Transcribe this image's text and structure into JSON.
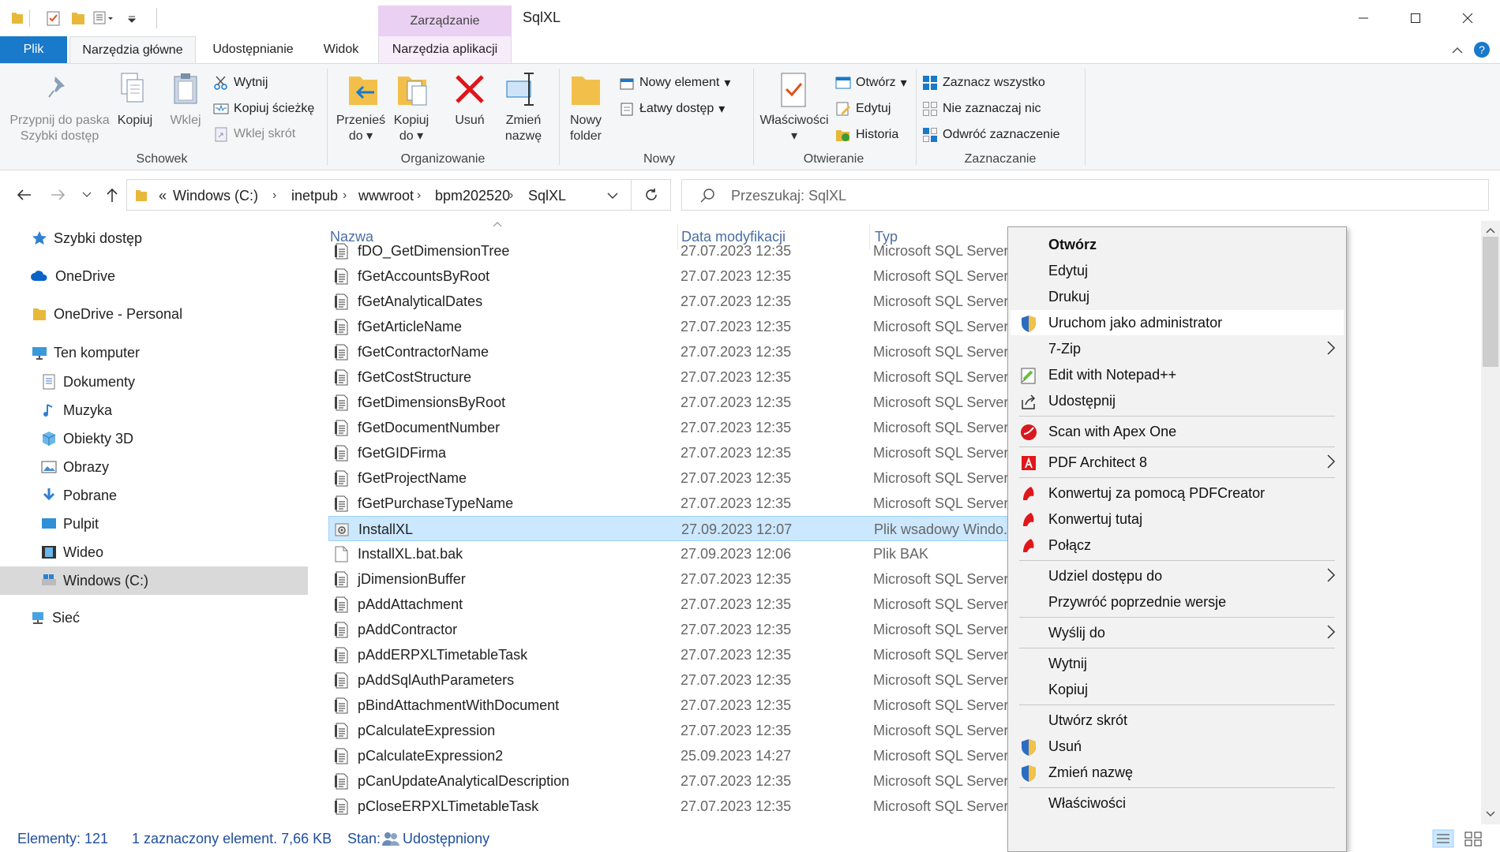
{
  "window": {
    "title": "SqlXL",
    "context_group": "Zarządzanie"
  },
  "ribbon_tabs": [
    {
      "label": "Plik"
    },
    {
      "label": "Narzędzia główne"
    },
    {
      "label": "Udostępnianie"
    },
    {
      "label": "Widok"
    },
    {
      "label": "Narzędzia aplikacji"
    }
  ],
  "ribbon": {
    "schowek": {
      "pin_line1": "Przypnij do paska",
      "pin_line2": "Szybki dostęp",
      "copy": "Kopiuj",
      "paste": "Wklej",
      "cut": "Wytnij",
      "copy_path": "Kopiuj ścieżkę",
      "paste_shortcut": "Wklej skrót",
      "group": "Schowek"
    },
    "organizowanie": {
      "move_line1": "Przenieś",
      "move_line2": "do",
      "copyto_line1": "Kopiuj",
      "copyto_line2": "do",
      "delete": "Usuń",
      "rename_line1": "Zmień",
      "rename_line2": "nazwę",
      "group": "Organizowanie"
    },
    "nowy": {
      "new_folder_line1": "Nowy",
      "new_folder_line2": "folder",
      "new_item": "Nowy element",
      "easy_access": "Łatwy dostęp",
      "group": "Nowy"
    },
    "otwieranie": {
      "properties": "Właściwości",
      "open": "Otwórz",
      "edit": "Edytuj",
      "history": "Historia",
      "group": "Otwieranie"
    },
    "zaznaczanie": {
      "select_all": "Zaznacz wszystko",
      "select_none": "Nie zaznaczaj nic",
      "invert": "Odwróć zaznaczenie",
      "group": "Zaznaczanie"
    }
  },
  "address": {
    "overflow": "«",
    "crumbs": [
      "Windows (C:)",
      "inetpub",
      "wwwroot",
      "bpm202520",
      "SqlXL"
    ],
    "search_placeholder": "Przeszukaj: SqlXL"
  },
  "nav": [
    {
      "label": "Szybki dostęp",
      "icon": "star-icon"
    },
    {
      "label": "OneDrive",
      "icon": "cloud-icon"
    },
    {
      "label": "OneDrive - Personal",
      "icon": "folder-icon"
    },
    {
      "label": "Ten komputer",
      "icon": "computer-icon"
    },
    {
      "label": "Dokumenty",
      "icon": "documents-icon"
    },
    {
      "label": "Muzyka",
      "icon": "music-icon"
    },
    {
      "label": "Obiekty 3D",
      "icon": "cube-icon"
    },
    {
      "label": "Obrazy",
      "icon": "pictures-icon"
    },
    {
      "label": "Pobrane",
      "icon": "download-icon"
    },
    {
      "label": "Pulpit",
      "icon": "desktop-icon"
    },
    {
      "label": "Wideo",
      "icon": "video-icon"
    },
    {
      "label": "Windows (C:)",
      "icon": "drive-icon"
    },
    {
      "label": "Sieć",
      "icon": "network-icon"
    }
  ],
  "columns": {
    "name": "Nazwa",
    "date": "Data modyfikacji",
    "type": "Typ"
  },
  "files": [
    {
      "name": "fDO_GetDimensionTree",
      "date": "27.07.2023 12:35",
      "type": "Microsoft SQL Server"
    },
    {
      "name": "fGetAccountsByRoot",
      "date": "27.07.2023 12:35",
      "type": "Microsoft SQL Server"
    },
    {
      "name": "fGetAnalyticalDates",
      "date": "27.07.2023 12:35",
      "type": "Microsoft SQL Server"
    },
    {
      "name": "fGetArticleName",
      "date": "27.07.2023 12:35",
      "type": "Microsoft SQL Server"
    },
    {
      "name": "fGetContractorName",
      "date": "27.07.2023 12:35",
      "type": "Microsoft SQL Server"
    },
    {
      "name": "fGetCostStructure",
      "date": "27.07.2023 12:35",
      "type": "Microsoft SQL Server"
    },
    {
      "name": "fGetDimensionsByRoot",
      "date": "27.07.2023 12:35",
      "type": "Microsoft SQL Server"
    },
    {
      "name": "fGetDocumentNumber",
      "date": "27.07.2023 12:35",
      "type": "Microsoft SQL Server"
    },
    {
      "name": "fGetGIDFirma",
      "date": "27.07.2023 12:35",
      "type": "Microsoft SQL Server"
    },
    {
      "name": "fGetProjectName",
      "date": "27.07.2023 12:35",
      "type": "Microsoft SQL Server"
    },
    {
      "name": "fGetPurchaseTypeName",
      "date": "27.07.2023 12:35",
      "type": "Microsoft SQL Server"
    },
    {
      "name": "InstallXL",
      "date": "27.09.2023 12:07",
      "type": "Plik wsadowy Windo...",
      "selected": true,
      "kind": "bat"
    },
    {
      "name": "InstallXL.bat.bak",
      "date": "27.09.2023 12:06",
      "type": "Plik BAK",
      "kind": "blank"
    },
    {
      "name": "jDimensionBuffer",
      "date": "27.07.2023 12:35",
      "type": "Microsoft SQL Server"
    },
    {
      "name": "pAddAttachment",
      "date": "27.07.2023 12:35",
      "type": "Microsoft SQL Server"
    },
    {
      "name": "pAddContractor",
      "date": "27.07.2023 12:35",
      "type": "Microsoft SQL Server"
    },
    {
      "name": "pAddERPXLTimetableTask",
      "date": "27.07.2023 12:35",
      "type": "Microsoft SQL Server"
    },
    {
      "name": "pAddSqlAuthParameters",
      "date": "27.07.2023 12:35",
      "type": "Microsoft SQL Server"
    },
    {
      "name": "pBindAttachmentWithDocument",
      "date": "27.07.2023 12:35",
      "type": "Microsoft SQL Server"
    },
    {
      "name": "pCalculateExpression",
      "date": "27.07.2023 12:35",
      "type": "Microsoft SQL Server"
    },
    {
      "name": "pCalculateExpression2",
      "date": "25.09.2023 14:27",
      "type": "Microsoft SQL Server"
    },
    {
      "name": "pCanUpdateAnalyticalDescription",
      "date": "27.07.2023 12:35",
      "type": "Microsoft SQL Server"
    },
    {
      "name": "pCloseERPXLTimetableTask",
      "date": "27.07.2023 12:35",
      "type": "Microsoft SQL Server"
    }
  ],
  "status": {
    "count": "Elementy: 121",
    "selection": "1 zaznaczony element. 7,66 KB",
    "state_label": "Stan:",
    "state_value": "Udostępniony"
  },
  "context_menu": [
    {
      "label": "Otwórz",
      "bold": true
    },
    {
      "label": "Edytuj"
    },
    {
      "label": "Drukuj"
    },
    {
      "label": "Uruchom jako administrator",
      "icon": "shield-icon",
      "hover": true
    },
    {
      "label": "7-Zip",
      "submenu": true
    },
    {
      "label": "Edit with Notepad++",
      "icon": "notepadpp-icon"
    },
    {
      "label": "Udostępnij",
      "icon": "share-icon"
    },
    {
      "sep": true
    },
    {
      "label": "Scan with Apex One",
      "icon": "apex-icon"
    },
    {
      "sep": true
    },
    {
      "label": "PDF Architect 8",
      "icon": "pdf-architect-icon",
      "submenu": true
    },
    {
      "sep": true
    },
    {
      "label": "Konwertuj za pomocą PDFCreator",
      "icon": "pdfcreator-icon"
    },
    {
      "label": "Konwertuj tutaj",
      "icon": "pdfcreator-icon"
    },
    {
      "label": "Połącz",
      "icon": "pdfcreator-icon"
    },
    {
      "sep": true
    },
    {
      "label": "Udziel dostępu do",
      "submenu": true
    },
    {
      "label": "Przywróć poprzednie wersje"
    },
    {
      "sep": true
    },
    {
      "label": "Wyślij do",
      "submenu": true
    },
    {
      "sep": true
    },
    {
      "label": "Wytnij"
    },
    {
      "label": "Kopiuj"
    },
    {
      "sep": true
    },
    {
      "label": "Utwórz skrót"
    },
    {
      "label": "Usuń",
      "icon": "shield-icon"
    },
    {
      "label": "Zmień nazwę",
      "icon": "shield-icon"
    },
    {
      "sep": true
    },
    {
      "label": "Właściwości"
    }
  ],
  "colors": {
    "file_tab": "#1979ca",
    "context_tab": "#ead0f3",
    "selection": "#cce8ff",
    "link_blue": "#1f4fa0"
  }
}
